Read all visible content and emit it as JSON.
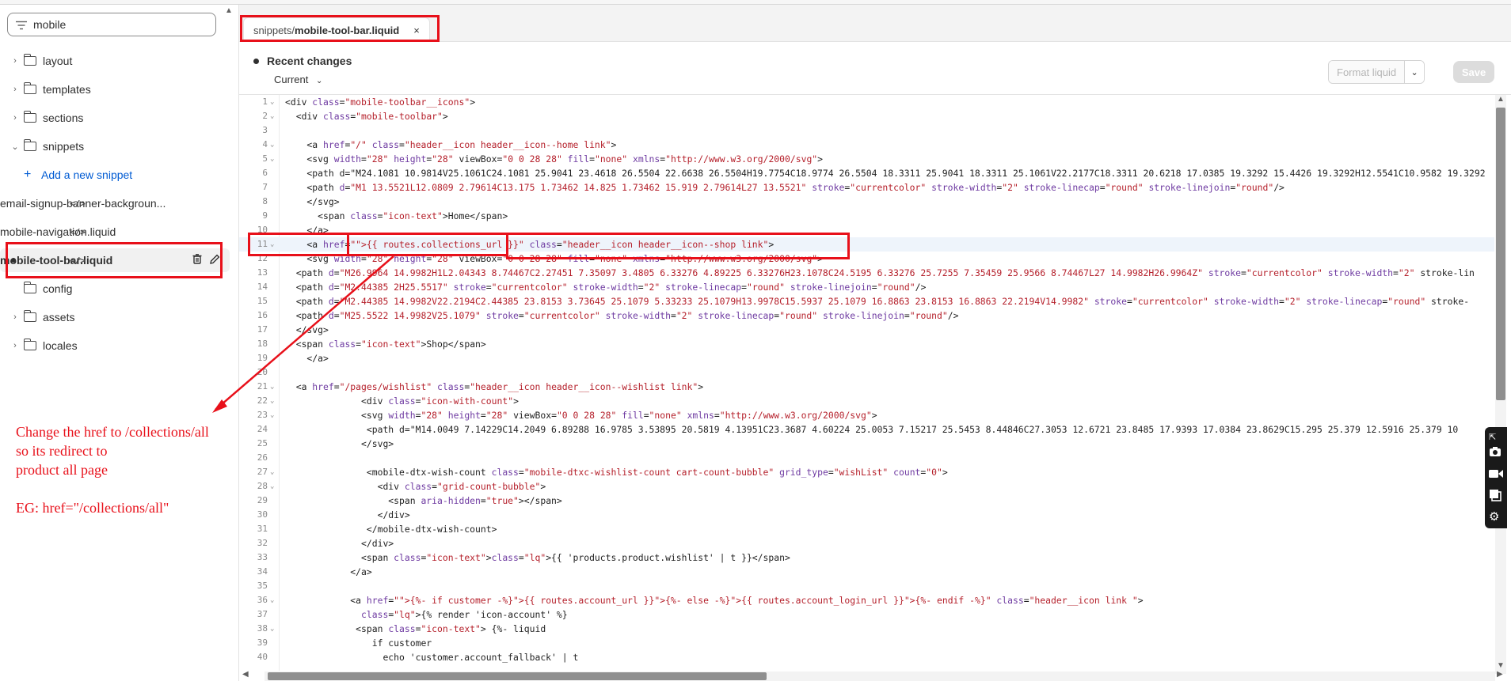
{
  "sidebar": {
    "search_value": "mobile",
    "items": [
      {
        "label": "layout"
      },
      {
        "label": "templates"
      },
      {
        "label": "sections"
      },
      {
        "label": "snippets"
      },
      {
        "label": "Add a new snippet"
      },
      {
        "label": "email-signup-banner-backgroun..."
      },
      {
        "label": "mobile-navigation.liquid"
      },
      {
        "label": "mobile-tool-bar.liquid"
      },
      {
        "label": "config"
      },
      {
        "label": "assets"
      },
      {
        "label": "locales"
      }
    ]
  },
  "annotation": {
    "line1": "Change the href to /collections/all",
    "line2": "so its redirect to",
    "line3": "product all page",
    "line4": "EG: href=\"/collections/all\""
  },
  "editor": {
    "tab_path": "snippets/",
    "tab_file": "mobile-tool-bar.liquid",
    "tab_close": "×",
    "recent_changes": "Recent changes",
    "current_label": "Current",
    "format_label": "Format liquid",
    "save_label": "Save"
  },
  "code_lines": [
    {
      "n": "1",
      "t": "<div class=\"mobile-toolbar__icons\">"
    },
    {
      "n": "2",
      "t": "  <div class=\"mobile-toolbar\">"
    },
    {
      "n": "3",
      "t": ""
    },
    {
      "n": "4",
      "t": "    <a href=\"/\" class=\"header__icon header__icon--home link\">"
    },
    {
      "n": "5",
      "t": "    <svg width=\"28\" height=\"28\" viewBox=\"0 0 28 28\" fill=\"none\" xmlns=\"http://www.w3.org/2000/svg\">"
    },
    {
      "n": "6",
      "t": "    <path d=\"M24.1081 10.9814V25.1061C24.1081 25.9041 23.4618 26.5504 22.6638 26.5504H19.7754C18.9774 26.5504 18.3311 25.9041 18.3311 25.1061V22.2177C18.3311 20.6218 17.0385 19.3292 15.4426 19.3292H12.5541C10.9582 19.3292"
    },
    {
      "n": "7",
      "t": "    <path d=\"M1 13.5521L12.0809 2.79614C13.175 1.73462 14.825 1.73462 15.919 2.79614L27 13.5521\" stroke=\"currentcolor\" stroke-width=\"2\" stroke-linecap=\"round\" stroke-linejoin=\"round\"/>"
    },
    {
      "n": "8",
      "t": "    </svg>"
    },
    {
      "n": "9",
      "t": "      <span class=\"icon-text\">Home</span>"
    },
    {
      "n": "10",
      "t": "    </a>"
    },
    {
      "n": "11",
      "t": "    <a href=\"{{ routes.collections_url }}\" class=\"header__icon header__icon--shop link\">"
    },
    {
      "n": "12",
      "t": "    <svg width=\"28\" height=\"28\" viewBox=\"0 0 28 28\" fill=\"none\" xmlns=\"http://www.w3.org/2000/svg\">"
    },
    {
      "n": "13",
      "t": "  <path d=\"M26.9964 14.9982H1L2.04343 8.74467C2.27451 7.35097 3.4805 6.33276 4.89225 6.33276H23.1078C24.5195 6.33276 25.7255 7.35459 25.9566 8.74467L27 14.9982H26.9964Z\" stroke=\"currentcolor\" stroke-width=\"2\" stroke-lin"
    },
    {
      "n": "14",
      "t": "  <path d=\"M2.44385 2H25.5517\" stroke=\"currentcolor\" stroke-width=\"2\" stroke-linecap=\"round\" stroke-linejoin=\"round\"/>"
    },
    {
      "n": "15",
      "t": "  <path d=\"M2.44385 14.9982V22.2194C2.44385 23.8153 3.73645 25.1079 5.33233 25.1079H13.9978C15.5937 25.1079 16.8863 23.8153 16.8863 22.2194V14.9982\" stroke=\"currentcolor\" stroke-width=\"2\" stroke-linecap=\"round\" stroke-"
    },
    {
      "n": "16",
      "t": "  <path d=\"M25.5522 14.9982V25.1079\" stroke=\"currentcolor\" stroke-width=\"2\" stroke-linecap=\"round\" stroke-linejoin=\"round\"/>"
    },
    {
      "n": "17",
      "t": "  </svg>"
    },
    {
      "n": "18",
      "t": "  <span class=\"icon-text\">Shop</span>"
    },
    {
      "n": "19",
      "t": "    </a>"
    },
    {
      "n": "20",
      "t": ""
    },
    {
      "n": "21",
      "t": "  <a href=\"/pages/wishlist\" class=\"header__icon header__icon--wishlist link\">"
    },
    {
      "n": "22",
      "t": "              <div class=\"icon-with-count\">"
    },
    {
      "n": "23",
      "t": "              <svg width=\"28\" height=\"28\" viewBox=\"0 0 28 28\" fill=\"none\" xmlns=\"http://www.w3.org/2000/svg\">"
    },
    {
      "n": "24",
      "t": "               <path d=\"M14.0049 7.14229C14.2049 6.89288 16.9785 3.53895 20.5819 4.13951C23.3687 4.60224 25.0053 7.15217 25.5453 8.44846C27.3053 12.6721 23.8485 17.9393 17.0384 23.8629C15.295 25.379 12.5916 25.379 10"
    },
    {
      "n": "25",
      "t": "              </svg>"
    },
    {
      "n": "26",
      "t": ""
    },
    {
      "n": "27",
      "t": "               <mobile-dtx-wish-count class=\"mobile-dtxc-wishlist-count cart-count-bubble\" grid_type=\"wishList\" count=\"0\">"
    },
    {
      "n": "28",
      "t": "                 <div class=\"grid-count-bubble\">"
    },
    {
      "n": "29",
      "t": "                   <span aria-hidden=\"true\"></span>"
    },
    {
      "n": "30",
      "t": "                 </div>"
    },
    {
      "n": "31",
      "t": "               </mobile-dtx-wish-count>"
    },
    {
      "n": "32",
      "t": "              </div>"
    },
    {
      "n": "33",
      "t": "              <span class=\"icon-text\">{{ 'products.product.wishlist' | t }}</span>"
    },
    {
      "n": "34",
      "t": "            </a>"
    },
    {
      "n": "35",
      "t": ""
    },
    {
      "n": "36",
      "t": "            <a href=\"{%- if customer -%}{{ routes.account_url }}{%- else -%}{{ routes.account_login_url }}{%- endif -%}\" class=\"header__icon link \">"
    },
    {
      "n": "37",
      "t": "              {% render 'icon-account' %}"
    },
    {
      "n": "38",
      "t": "             <span class=\"icon-text\"> {%- liquid"
    },
    {
      "n": "39",
      "t": "                if customer"
    },
    {
      "n": "40",
      "t": "                  echo 'customer.account_fallback' | t"
    }
  ]
}
